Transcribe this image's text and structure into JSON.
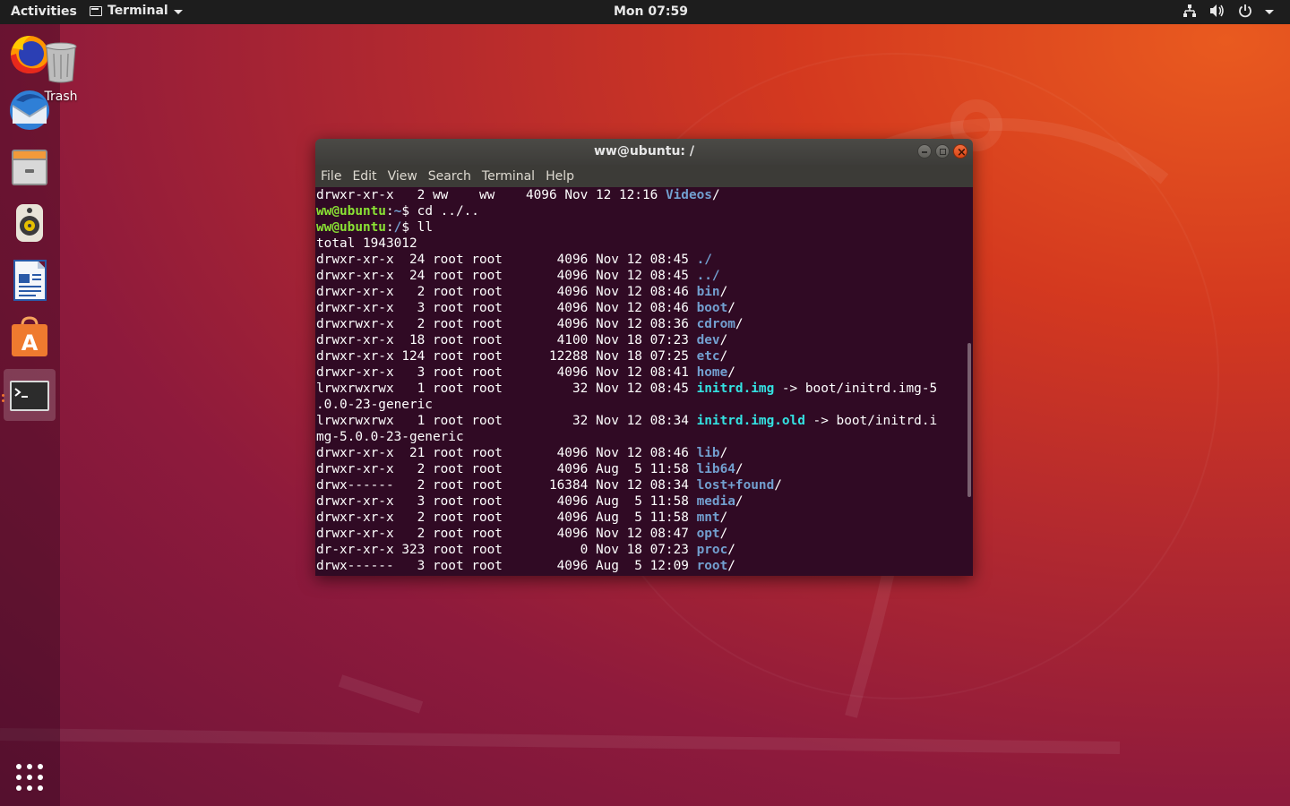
{
  "topbar": {
    "activities": "Activities",
    "app_name": "Terminal",
    "clock": "Mon 07:59",
    "icons": [
      "network-icon",
      "volume-icon",
      "power-icon",
      "chevron-down-icon"
    ]
  },
  "dock": {
    "items": [
      "firefox-icon",
      "thunderbird-icon",
      "files-icon",
      "rhythmbox-icon",
      "writer-icon",
      "software-icon",
      "terminal-icon"
    ],
    "apps_icon": "show-applications-icon"
  },
  "desktop": {
    "trash_label": "Trash"
  },
  "window": {
    "title": "ww@ubuntu: /",
    "menu": [
      "File",
      "Edit",
      "View",
      "Search",
      "Terminal",
      "Help"
    ]
  },
  "terminal": {
    "lines": [
      {
        "t": "ls",
        "perm": "drwxr-xr-x",
        "n": "  2",
        "u": "ww  ",
        "g": " ww  ",
        "sz": " 4096",
        "date": "Nov 12 12:16",
        "name": "Videos",
        "kind": "dir",
        "suffix": "/"
      },
      {
        "t": "prompt",
        "user": "ww@ubuntu",
        "path": "~",
        "cmd": "$ cd ../.."
      },
      {
        "t": "prompt",
        "user": "ww@ubuntu",
        "path": "/",
        "cmd": "$ ll"
      },
      {
        "t": "plain",
        "text": "total 1943012"
      },
      {
        "t": "ls",
        "perm": "drwxr-xr-x",
        "n": " 24",
        "u": "root",
        "g": "root",
        "sz": "      4096",
        "date": "Nov 12 08:45",
        "name": "./",
        "kind": "dir",
        "suffix": ""
      },
      {
        "t": "ls",
        "perm": "drwxr-xr-x",
        "n": " 24",
        "u": "root",
        "g": "root",
        "sz": "      4096",
        "date": "Nov 12 08:45",
        "name": "../",
        "kind": "dir",
        "suffix": ""
      },
      {
        "t": "ls",
        "perm": "drwxr-xr-x",
        "n": "  2",
        "u": "root",
        "g": "root",
        "sz": "      4096",
        "date": "Nov 12 08:46",
        "name": "bin",
        "kind": "dir",
        "suffix": "/"
      },
      {
        "t": "ls",
        "perm": "drwxr-xr-x",
        "n": "  3",
        "u": "root",
        "g": "root",
        "sz": "      4096",
        "date": "Nov 12 08:46",
        "name": "boot",
        "kind": "dir",
        "suffix": "/"
      },
      {
        "t": "ls",
        "perm": "drwxrwxr-x",
        "n": "  2",
        "u": "root",
        "g": "root",
        "sz": "      4096",
        "date": "Nov 12 08:36",
        "name": "cdrom",
        "kind": "dir",
        "suffix": "/"
      },
      {
        "t": "ls",
        "perm": "drwxr-xr-x",
        "n": " 18",
        "u": "root",
        "g": "root",
        "sz": "      4100",
        "date": "Nov 18 07:23",
        "name": "dev",
        "kind": "dir",
        "suffix": "/"
      },
      {
        "t": "ls",
        "perm": "drwxr-xr-x",
        "n": "124",
        "u": "root",
        "g": "root",
        "sz": "     12288",
        "date": "Nov 18 07:25",
        "name": "etc",
        "kind": "dir",
        "suffix": "/"
      },
      {
        "t": "ls",
        "perm": "drwxr-xr-x",
        "n": "  3",
        "u": "root",
        "g": "root",
        "sz": "      4096",
        "date": "Nov 12 08:41",
        "name": "home",
        "kind": "dir",
        "suffix": "/"
      },
      {
        "t": "ls",
        "perm": "lrwxrwxrwx",
        "n": "  1",
        "u": "root",
        "g": "root",
        "sz": "        32",
        "date": "Nov 12 08:45",
        "name": "initrd.img",
        "kind": "link",
        "suffix": " -> boot/initrd.img-5"
      },
      {
        "t": "plain",
        "text": ".0.0-23-generic"
      },
      {
        "t": "ls",
        "perm": "lrwxrwxrwx",
        "n": "  1",
        "u": "root",
        "g": "root",
        "sz": "        32",
        "date": "Nov 12 08:34",
        "name": "initrd.img.old",
        "kind": "link",
        "suffix": " -> boot/initrd.i"
      },
      {
        "t": "plain",
        "text": "mg-5.0.0-23-generic"
      },
      {
        "t": "ls",
        "perm": "drwxr-xr-x",
        "n": " 21",
        "u": "root",
        "g": "root",
        "sz": "      4096",
        "date": "Nov 12 08:46",
        "name": "lib",
        "kind": "dir",
        "suffix": "/"
      },
      {
        "t": "ls",
        "perm": "drwxr-xr-x",
        "n": "  2",
        "u": "root",
        "g": "root",
        "sz": "      4096",
        "date": "Aug  5 11:58",
        "name": "lib64",
        "kind": "dir",
        "suffix": "/"
      },
      {
        "t": "ls",
        "perm": "drwx------",
        "n": "  2",
        "u": "root",
        "g": "root",
        "sz": "     16384",
        "date": "Nov 12 08:34",
        "name": "lost+found",
        "kind": "dir",
        "suffix": "/"
      },
      {
        "t": "ls",
        "perm": "drwxr-xr-x",
        "n": "  3",
        "u": "root",
        "g": "root",
        "sz": "      4096",
        "date": "Aug  5 11:58",
        "name": "media",
        "kind": "dir",
        "suffix": "/"
      },
      {
        "t": "ls",
        "perm": "drwxr-xr-x",
        "n": "  2",
        "u": "root",
        "g": "root",
        "sz": "      4096",
        "date": "Aug  5 11:58",
        "name": "mnt",
        "kind": "dir",
        "suffix": "/"
      },
      {
        "t": "ls",
        "perm": "drwxr-xr-x",
        "n": "  2",
        "u": "root",
        "g": "root",
        "sz": "      4096",
        "date": "Nov 12 08:47",
        "name": "opt",
        "kind": "dir",
        "suffix": "/"
      },
      {
        "t": "ls",
        "perm": "dr-xr-xr-x",
        "n": "323",
        "u": "root",
        "g": "root",
        "sz": "         0",
        "date": "Nov 18 07:23",
        "name": "proc",
        "kind": "dir",
        "suffix": "/"
      },
      {
        "t": "ls",
        "perm": "drwx------",
        "n": "  3",
        "u": "root",
        "g": "root",
        "sz": "      4096",
        "date": "Aug  5 12:09",
        "name": "root",
        "kind": "dir",
        "suffix": "/"
      }
    ]
  },
  "colors": {
    "terminal_bg": "#300a24",
    "prompt_user": "#8ae234",
    "dir": "#729fcf",
    "link": "#34e2e2",
    "accent": "#e95420"
  }
}
